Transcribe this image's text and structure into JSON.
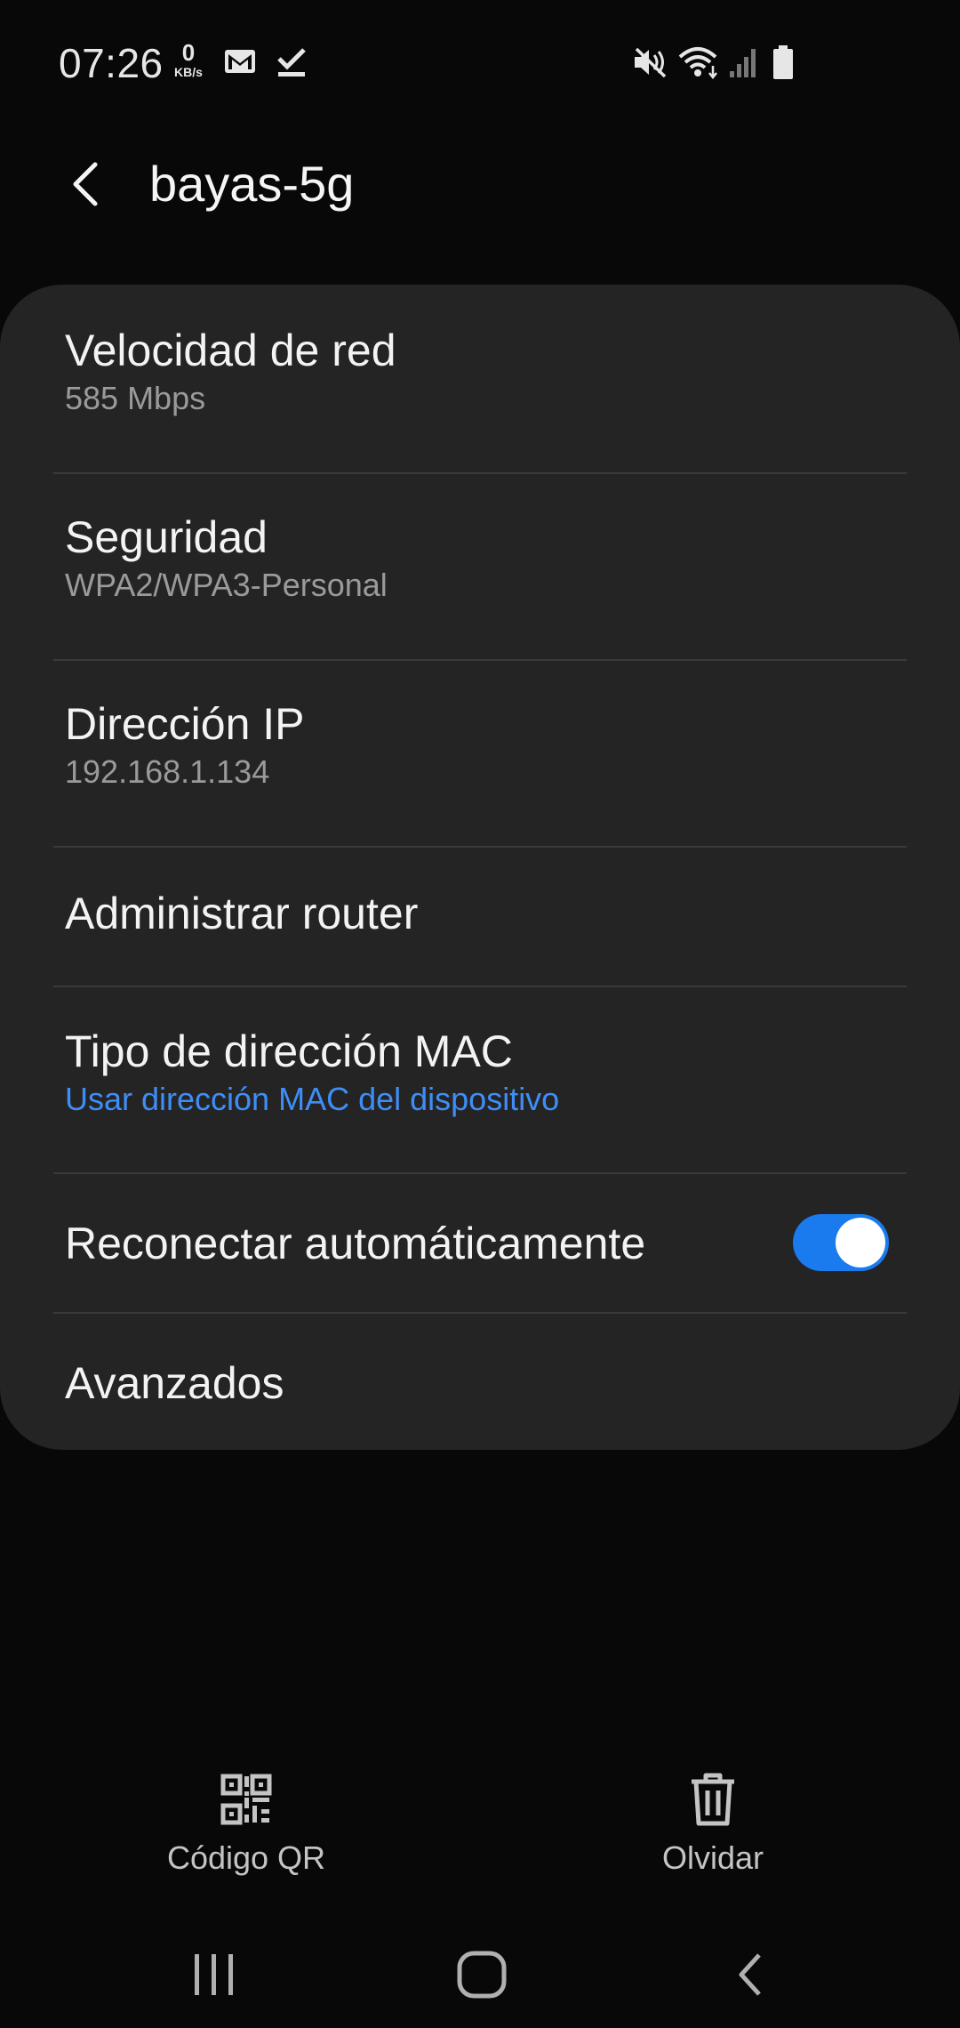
{
  "status_bar": {
    "time": "07:26",
    "net_speed_value": "0",
    "net_speed_unit": "KB/s",
    "icons": [
      "gmail-icon",
      "download-done-icon",
      "mute-icon",
      "wifi-icon",
      "signal-icon",
      "battery-icon"
    ]
  },
  "header": {
    "back_icon": "back-arrow-icon",
    "title": "bayas-5g"
  },
  "settings": {
    "network_speed": {
      "title": "Velocidad de red",
      "value": "585 Mbps"
    },
    "security": {
      "title": "Seguridad",
      "value": "WPA2/WPA3-Personal"
    },
    "ip_address": {
      "title": "Dirección IP",
      "value": "192.168.1.134"
    },
    "manage_router": {
      "title": "Administrar router"
    },
    "mac_type": {
      "title": "Tipo de dirección MAC",
      "value": "Usar dirección MAC del dispositivo"
    },
    "auto_reconnect": {
      "title": "Reconectar automáticamente",
      "enabled": true
    },
    "advanced": {
      "title": "Avanzados"
    }
  },
  "actions": {
    "qr": {
      "label": "Código QR",
      "icon": "qr-code-icon"
    },
    "forget": {
      "label": "Olvidar",
      "icon": "trash-icon"
    }
  },
  "nav_bar": {
    "icons": [
      "recents-icon",
      "home-icon",
      "back-icon"
    ]
  },
  "colors": {
    "background": "#080808",
    "card": "#242424",
    "accent": "#3e8ef7",
    "toggle_on": "#1a7bef"
  }
}
